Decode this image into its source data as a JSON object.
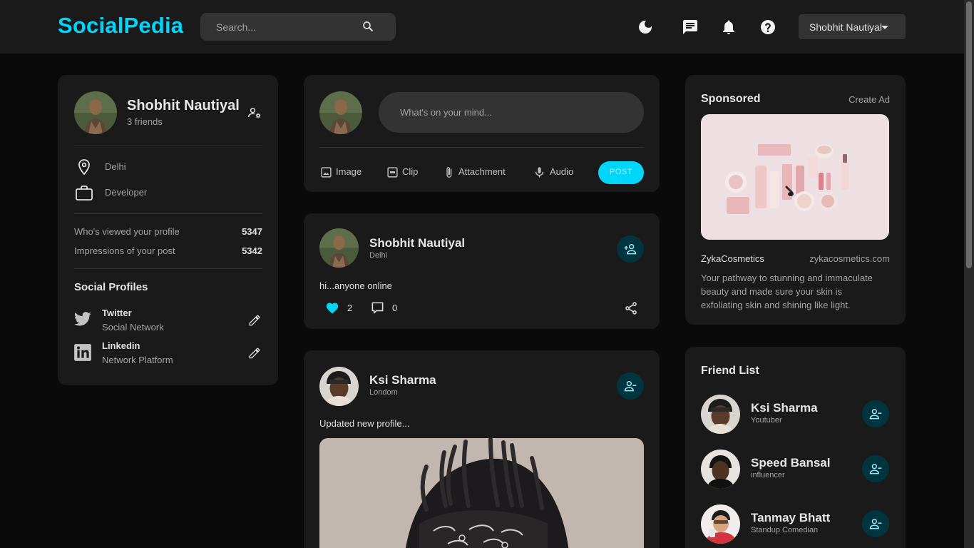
{
  "app": {
    "name": "SocialPedia"
  },
  "search": {
    "placeholder": "Search..."
  },
  "header": {
    "user_name": "Shobhit Nautiyal"
  },
  "profile": {
    "name": "Shobhit Nautiyal",
    "friends": "3 friends",
    "location": "Delhi",
    "occupation": "Developer",
    "views_label": "Who's viewed your profile",
    "views_value": "5347",
    "impressions_label": "Impressions of your post",
    "impressions_value": "5342",
    "social_title": "Social Profiles",
    "social": [
      {
        "name": "Twitter",
        "type": "Social Network"
      },
      {
        "name": "Linkedin",
        "type": "Network Platform"
      }
    ]
  },
  "composer": {
    "placeholder": "What's on your mind...",
    "actions": [
      "Image",
      "Clip",
      "Attachment",
      "Audio"
    ],
    "post_label": "POST"
  },
  "posts": [
    {
      "name": "Shobhit Nautiyal",
      "location": "Delhi",
      "text": "hi...anyone online",
      "likes": "2",
      "comments": "0"
    },
    {
      "name": "Ksi Sharma",
      "location": "Londom",
      "text": "Updated new profile..."
    }
  ],
  "ad": {
    "title": "Sponsored",
    "create": "Create Ad",
    "brand": "ZykaCosmetics",
    "site": "zykacosmetics.com",
    "description_lines": [
      "Your pathway to stunning and immaculate",
      "beauty and made sure your skin is",
      "exfoliating skin and shining like light."
    ]
  },
  "friends": {
    "title": "Friend List",
    "items": [
      {
        "name": "Ksi Sharma",
        "role": "Youtuber"
      },
      {
        "name": "Speed Bansal",
        "role": "influencer"
      },
      {
        "name": "Tanmay Bhatt",
        "role": "Standup Comedian"
      }
    ]
  },
  "colors": {
    "primary": "#00d5fa",
    "card": "#1a1a1a",
    "background": "#0a0a0a",
    "accent_dark": "#00353f",
    "alt_bg": "#333333"
  }
}
